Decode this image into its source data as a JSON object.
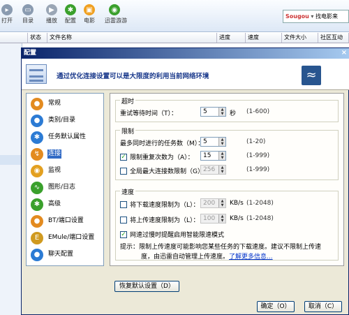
{
  "toolbar": {
    "open": "打开",
    "dir": "目录",
    "play": "播放",
    "config": "配置",
    "movie": "电影",
    "game": "迅雷游游",
    "search_brand": "Sougou",
    "search_text": "找电影来"
  },
  "list": {
    "status_col": "状态",
    "name_col": "文件名称",
    "progress_col": "进度",
    "speed_col": "速度",
    "size_col": "文件大小",
    "community_col": "社区互动"
  },
  "dialog": {
    "title": "配置",
    "close": "×",
    "banner_text": "通过优化连接设置可以是大限度的利用当前网络环境",
    "sidebar": [
      {
        "label": "常规",
        "icon": "general-icon",
        "color": "#e38b20"
      },
      {
        "label": "类别/目录",
        "icon": "category-icon",
        "color": "#2c7bd4"
      },
      {
        "label": "任务默认属性",
        "icon": "task-default-icon",
        "color": "#2c7bd4"
      },
      {
        "label": "连接",
        "icon": "connection-icon",
        "color": "#e38b20"
      },
      {
        "label": "监视",
        "icon": "monitor-icon",
        "color": "#e3a020"
      },
      {
        "label": "图形/日志",
        "icon": "graph-log-icon",
        "color": "#3aa02c"
      },
      {
        "label": "高级",
        "icon": "advanced-icon",
        "color": "#3aa02c"
      },
      {
        "label": "BT/端口设置",
        "icon": "bt-port-icon",
        "color": "#e38b20"
      },
      {
        "label": "EMule/端口设置",
        "icon": "emule-port-icon",
        "color": "#d09a20"
      },
      {
        "label": "聊天配置",
        "icon": "chat-config-icon",
        "color": "#2c7bd4"
      }
    ],
    "selected_index": 3,
    "timeout": {
      "title": "超时",
      "retry_label": "重试等待时间（T）：",
      "retry_value": "5",
      "retry_unit": "秒",
      "retry_range": "(1-600)"
    },
    "limit": {
      "title": "限制",
      "max_tasks_label": "最多同时进行的任务数（M）：",
      "max_tasks_value": "5",
      "max_tasks_range": "(1-20)",
      "retry_count_label": "限制重复次数为（A）：",
      "retry_count_checked": true,
      "retry_count_value": "15",
      "retry_count_range": "(1-999)",
      "global_conn_label": "全局最大连接数限制（G）",
      "global_conn_checked": false,
      "global_conn_value": "256",
      "global_conn_range": "(1-999)"
    },
    "speed": {
      "title": "速度",
      "download_label": "将下载速度限制为（L）：",
      "download_checked": false,
      "download_value": "200",
      "download_unit": "KB/s",
      "download_range": "(1-2048)",
      "upload_label": "将上传速度限制为（L）：",
      "upload_checked": false,
      "upload_value": "100",
      "upload_unit": "KB/s",
      "upload_range": "(1-2048)",
      "smart_label": "网速过慢时提醒启用智能限速模式",
      "smart_checked": true,
      "hint_line1": "提示：限制上传速度可能影响您某些任务的下载速度。建议不限制上传速",
      "hint_line2": "度，由迅雷自动管理上传速度。",
      "hint_link": "了解更多信息..."
    },
    "restore_button": "恢复默认设置（D）",
    "ok_button": "确定（O）",
    "cancel_button": "取消（C）"
  }
}
